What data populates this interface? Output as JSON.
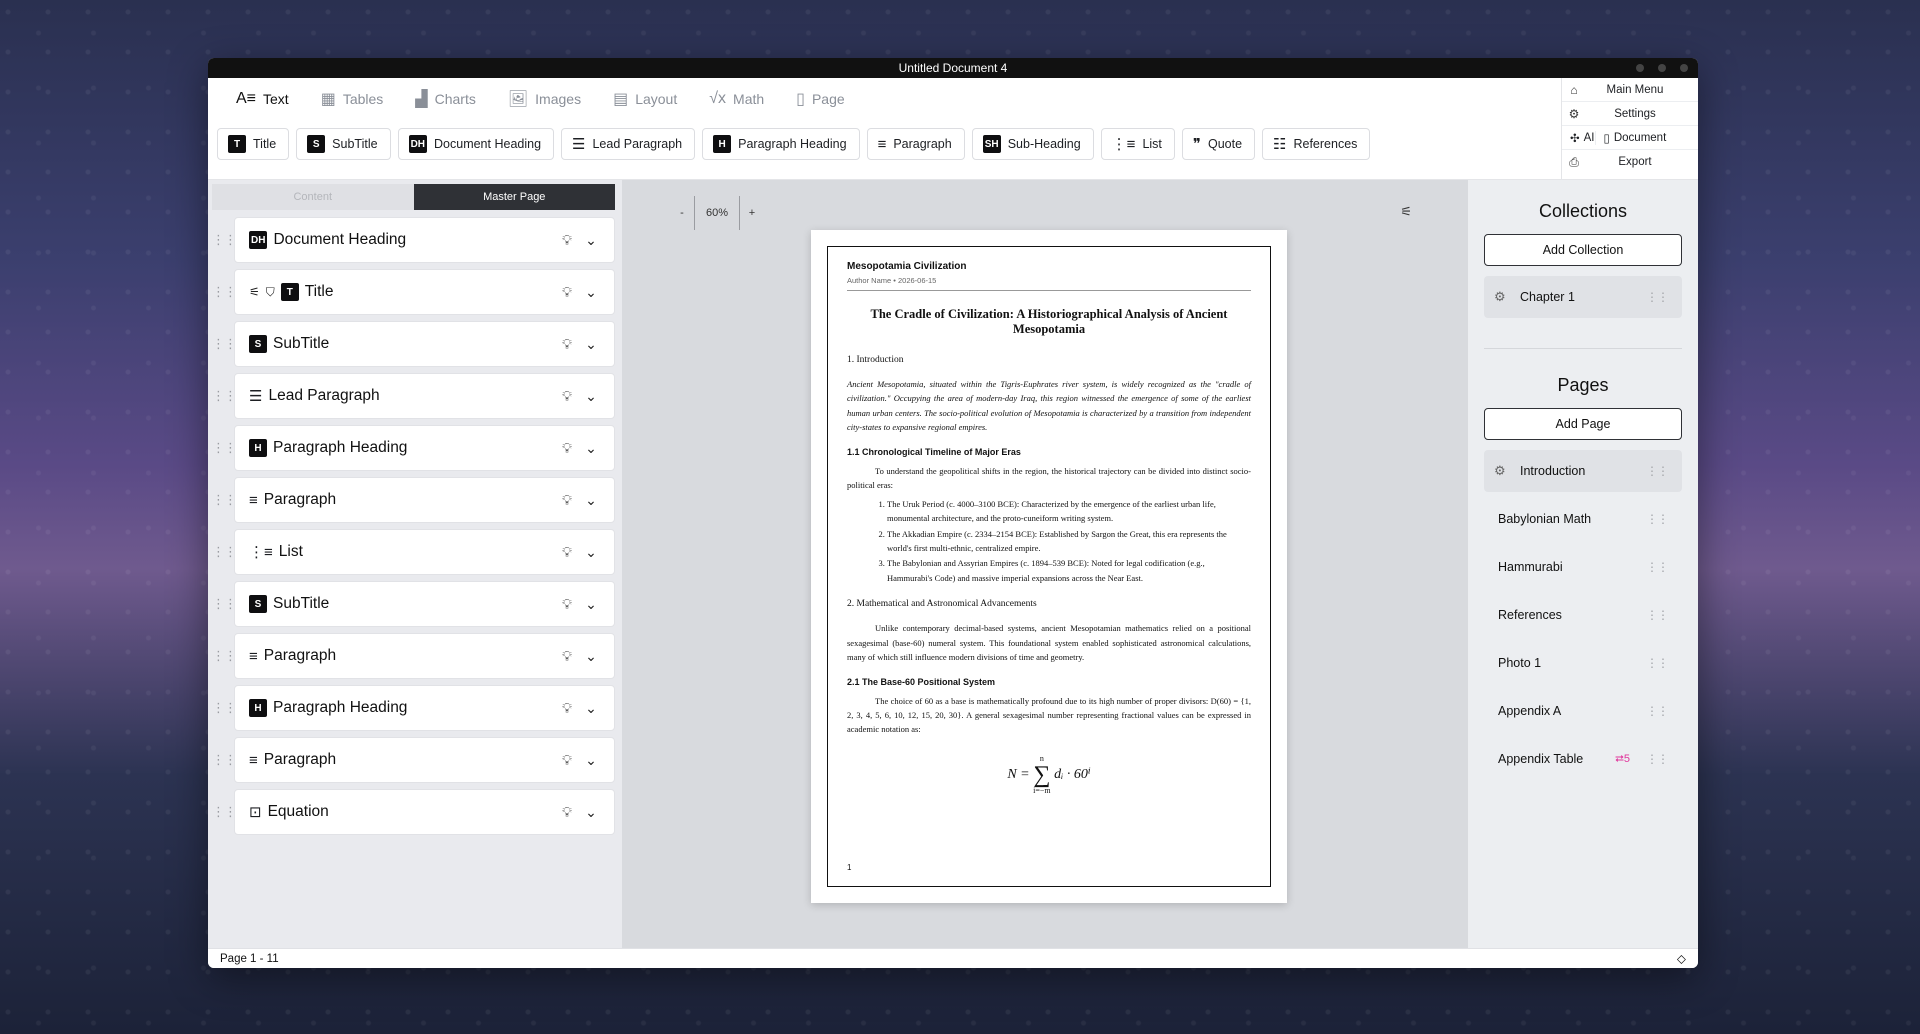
{
  "window": {
    "title": "Untitled Document 4"
  },
  "tabs": [
    {
      "label": "Text",
      "icon": "text-icon",
      "glyph": "A≡"
    },
    {
      "label": "Tables",
      "icon": "table-icon",
      "glyph": "▦"
    },
    {
      "label": "Charts",
      "icon": "chart-icon",
      "glyph": "▟"
    },
    {
      "label": "Images",
      "icon": "image-icon",
      "glyph": "🖼"
    },
    {
      "label": "Layout",
      "icon": "layout-icon",
      "glyph": "▤"
    },
    {
      "label": "Math",
      "icon": "math-icon",
      "glyph": "√x"
    },
    {
      "label": "Page",
      "icon": "page-icon",
      "glyph": "▯"
    }
  ],
  "tools": [
    {
      "label": "Title",
      "badge": "T"
    },
    {
      "label": "SubTitle",
      "badge": "S"
    },
    {
      "label": "Document Heading",
      "badge": "DH"
    },
    {
      "label": "Lead Paragraph",
      "glyph": "☰"
    },
    {
      "label": "Paragraph Heading",
      "badge": "H"
    },
    {
      "label": "Paragraph",
      "glyph": "≡"
    },
    {
      "label": "Sub-Heading",
      "badge": "SH"
    },
    {
      "label": "List",
      "glyph": "⋮≡"
    },
    {
      "label": "Quote",
      "glyph": "❞"
    },
    {
      "label": "References",
      "glyph": "☷"
    }
  ],
  "menu": {
    "main_menu": "Main Menu",
    "settings": "Settings",
    "ai": "AI",
    "document": "Document",
    "export": "Export"
  },
  "left": {
    "seg_content": "Content",
    "seg_master": "Master Page",
    "blocks": [
      {
        "name": "Document Heading",
        "badge": "DH"
      },
      {
        "name": "Title",
        "badge": "T",
        "extra": true
      },
      {
        "name": "SubTitle",
        "badge": "S"
      },
      {
        "name": "Lead Paragraph",
        "glyph": "☰"
      },
      {
        "name": "Paragraph Heading",
        "badge": "H"
      },
      {
        "name": "Paragraph",
        "glyph": "≡"
      },
      {
        "name": "List",
        "glyph": "⋮≡"
      },
      {
        "name": "SubTitle",
        "badge": "S"
      },
      {
        "name": "Paragraph",
        "glyph": "≡"
      },
      {
        "name": "Paragraph Heading",
        "badge": "H"
      },
      {
        "name": "Paragraph",
        "glyph": "≡"
      },
      {
        "name": "Equation",
        "glyph": "⊡"
      }
    ]
  },
  "canvas": {
    "zoom_minus": "-",
    "zoom_value": "60%",
    "zoom_plus": "+"
  },
  "doc": {
    "heading": "Mesopotamia Civilization",
    "meta": "Author Name  •  2026-06-15",
    "title": "The Cradle of Civilization: A Historiographical Analysis of Ancient Mesopotamia",
    "sec1": "1. Introduction",
    "lead": "Ancient Mesopotamia, situated within the Tigris-Euphrates river system, is widely recognized as the \"cradle of civilization.\" Occupying the area of modern-day Iraq, this region witnessed the emergence of some of the earliest human urban centers. The socio-political evolution of Mesopotamia is characterized by a transition from independent city-states to expansive regional empires.",
    "ph1": "1.1 Chronological Timeline of Major Eras",
    "p1": "To understand the geopolitical shifts in the region, the historical trajectory can be divided into distinct socio-political eras:",
    "list": [
      "The Uruk Period (c. 4000–3100 BCE): Characterized by the emergence of the earliest urban life, monumental architecture, and the proto-cuneiform writing system.",
      "The Akkadian Empire (c. 2334–2154 BCE): Established by Sargon the Great, this era represents the world's first multi-ethnic, centralized empire.",
      "The Babylonian and Assyrian Empires (c. 1894–539 BCE): Noted for legal codification (e.g., Hammurabi's Code) and massive imperial expansions across the Near East."
    ],
    "sec2": "2. Mathematical and Astronomical Advancements",
    "p2": "Unlike contemporary decimal-based systems, ancient Mesopotamian mathematics relied on a positional sexagesimal (base-60) numeral system. This foundational system enabled sophisticated astronomical calculations, many of which still influence modern divisions of time and geometry.",
    "ph2": "2.1 The Base-60 Positional System",
    "p3": "The choice of 60 as a base is mathematically profound due to its high number of proper divisors: D(60) = {1, 2, 3, 4, 5, 6, 10, 12, 15, 20, 30}. A general sexagesimal number representing fractional values can be expressed in academic notation as:",
    "eq_lhs": "N =",
    "eq_top": "n",
    "eq_bottom": "i=−m",
    "eq_rhs": "dᵢ · 60ⁱ",
    "page_number": "1"
  },
  "right": {
    "collections_title": "Collections",
    "add_collection": "Add Collection",
    "collections": [
      {
        "label": "Chapter 1"
      }
    ],
    "pages_title": "Pages",
    "add_page": "Add Page",
    "pages": [
      {
        "label": "Introduction",
        "selected": true
      },
      {
        "label": "Babylonian Math"
      },
      {
        "label": "Hammurabi"
      },
      {
        "label": "References"
      },
      {
        "label": "Photo 1"
      },
      {
        "label": "Appendix A"
      },
      {
        "label": "Appendix Table",
        "ext": "⮂5"
      }
    ]
  },
  "status": {
    "page_info": "Page 1 - 11"
  }
}
